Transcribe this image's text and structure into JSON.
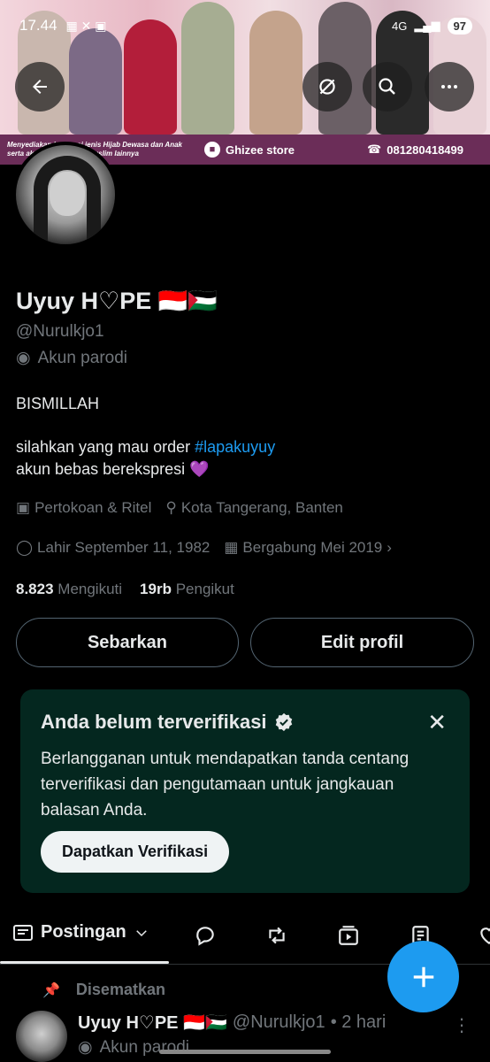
{
  "status_bar": {
    "time": "17.44",
    "network": "4G",
    "battery": "97"
  },
  "banner": {
    "tagline": "Menyediakan berbagai jenis Hijab Dewasa dan Anak serta aksesoris fashion muslim lainnya",
    "store": "Ghizee store",
    "phone": "081280418499"
  },
  "profile": {
    "name": "Uyuy H♡PE 🇮🇩🇵🇸",
    "handle": "@Nurulkjo1",
    "label": "Akun parodi",
    "bio_line1": "BISMILLAH",
    "bio_line2_prefix": "silahkan yang mau order ",
    "bio_hashtag": "#lapakuyuy",
    "bio_line3": "akun bebas berekspresi 💜",
    "category": "Pertokoan & Ritel",
    "location": "Kota Tangerang, Banten",
    "birthday": "Lahir September 11, 1982",
    "joined": "Bergabung Mei 2019",
    "following_count": "8.823",
    "following_label": "Mengikuti",
    "followers_count": "19rb",
    "followers_label": "Pengikut"
  },
  "actions": {
    "share": "Sebarkan",
    "edit": "Edit profil"
  },
  "verify_card": {
    "title": "Anda belum terverifikasi",
    "body": "Berlangganan untuk mendapatkan tanda centang terverifikasi dan pengutamaan untuk jangkauan balasan Anda.",
    "button": "Dapatkan Verifikasi"
  },
  "tabs": {
    "active": "Postingan"
  },
  "pinned": {
    "label": "Disematkan",
    "name": "Uyuy H♡PE 🇮🇩🇵🇸",
    "handle": "@Nurulkjo1",
    "time": "• 2 hari",
    "label2": "Akun parodi"
  },
  "colors": {
    "accent": "#1d9bf0",
    "card_bg": "#04271f",
    "banner_strip": "#6b2d58"
  },
  "icons": [
    "back-arrow-icon",
    "grok-icon",
    "search-icon",
    "more-icon",
    "theater-mask-icon",
    "briefcase-icon",
    "location-pin-icon",
    "balloon-icon",
    "calendar-icon",
    "chevron-right-icon",
    "verified-icon",
    "close-icon",
    "posts-icon",
    "chevron-down-icon",
    "reply-icon",
    "repost-icon",
    "media-icon",
    "articles-icon",
    "like-icon",
    "plus-icon",
    "pin-icon",
    "kebab-icon"
  ]
}
